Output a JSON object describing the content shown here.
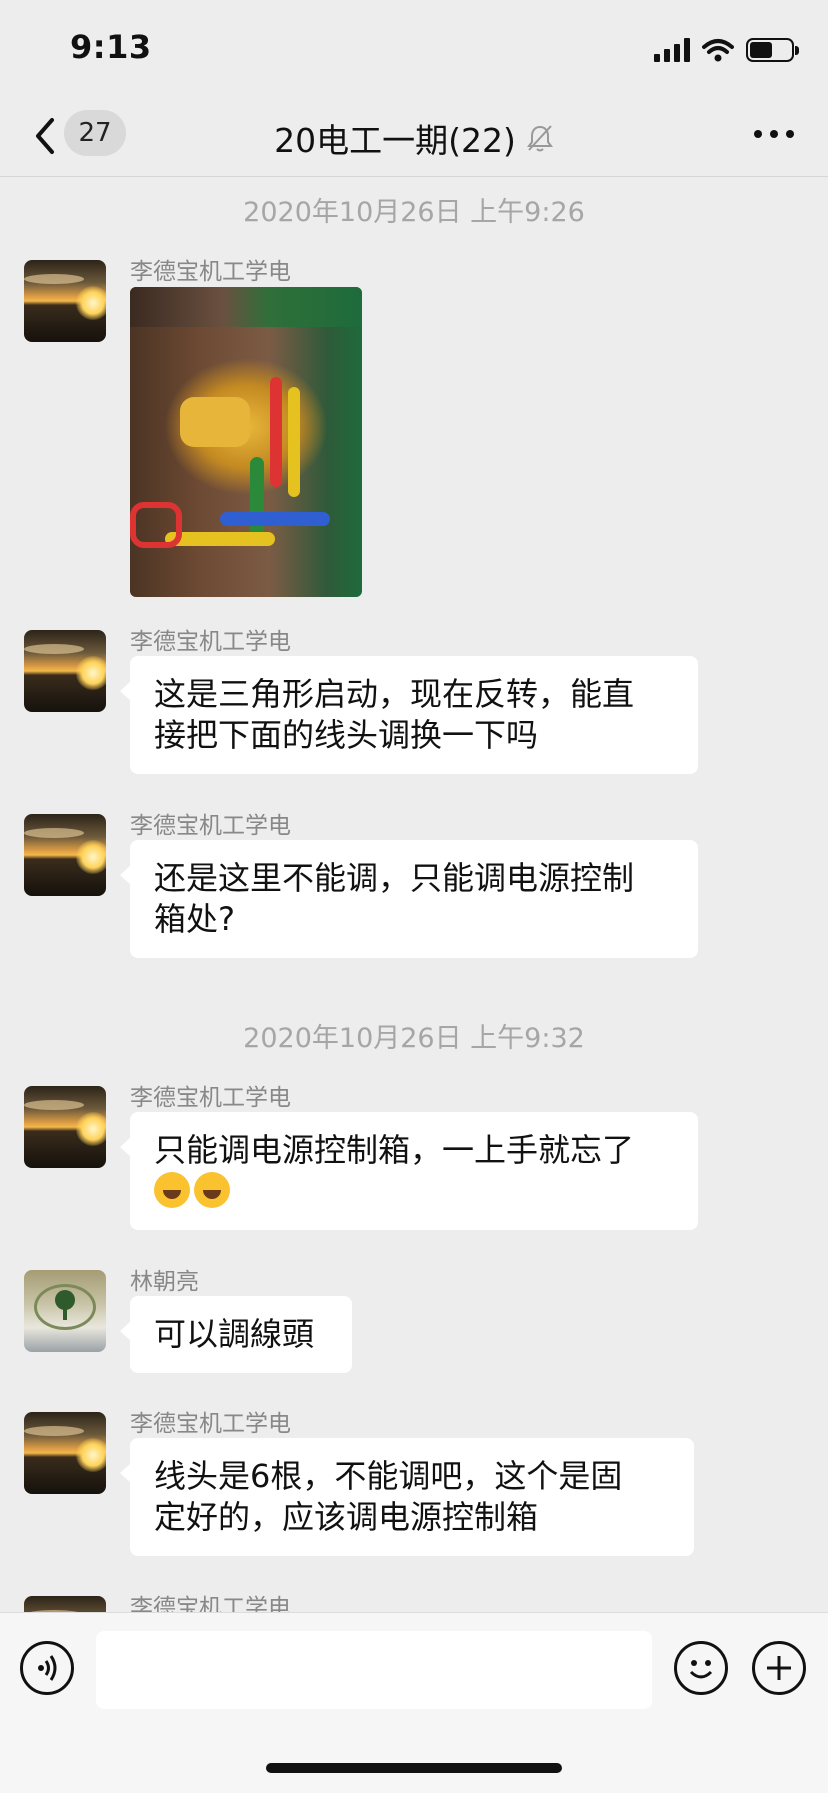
{
  "status_bar": {
    "time": "9:13",
    "battery_level": 0.55
  },
  "nav": {
    "unread_count": "27",
    "title": "20电工一期(22)"
  },
  "messages": [
    {
      "type": "timestamp",
      "text": "2020年10月26日 上午9:26"
    },
    {
      "type": "image",
      "sender": "李德宝机工学电",
      "avatar": "sunset"
    },
    {
      "type": "text",
      "sender": "李德宝机工学电",
      "avatar": "sunset",
      "lines": [
        "这是三角形启动，现在反转，能直",
        "接把下面的线头调换一下吗"
      ]
    },
    {
      "type": "text",
      "sender": "李德宝机工学电",
      "avatar": "sunset",
      "lines": [
        "还是这里不能调，只能调电源控制",
        "箱处?"
      ]
    },
    {
      "type": "timestamp",
      "text": "2020年10月26日 上午9:32"
    },
    {
      "type": "text",
      "sender": "李德宝机工学电",
      "avatar": "sunset",
      "lines": [
        "只能调电源控制箱，一上手就忘了"
      ],
      "emoji": "laughing-crying-emoji"
    },
    {
      "type": "text",
      "sender": "林朝亮",
      "avatar": "tree",
      "lines": [
        "可以調線頭"
      ]
    },
    {
      "type": "text",
      "sender": "李德宝机工学电",
      "avatar": "sunset",
      "lines": [
        "线头是6根，不能调吧，这个是固",
        "定好的，应该调电源控制箱"
      ]
    },
    {
      "type": "partial",
      "sender": "李德宝机工学电",
      "avatar": "sunset"
    }
  ]
}
